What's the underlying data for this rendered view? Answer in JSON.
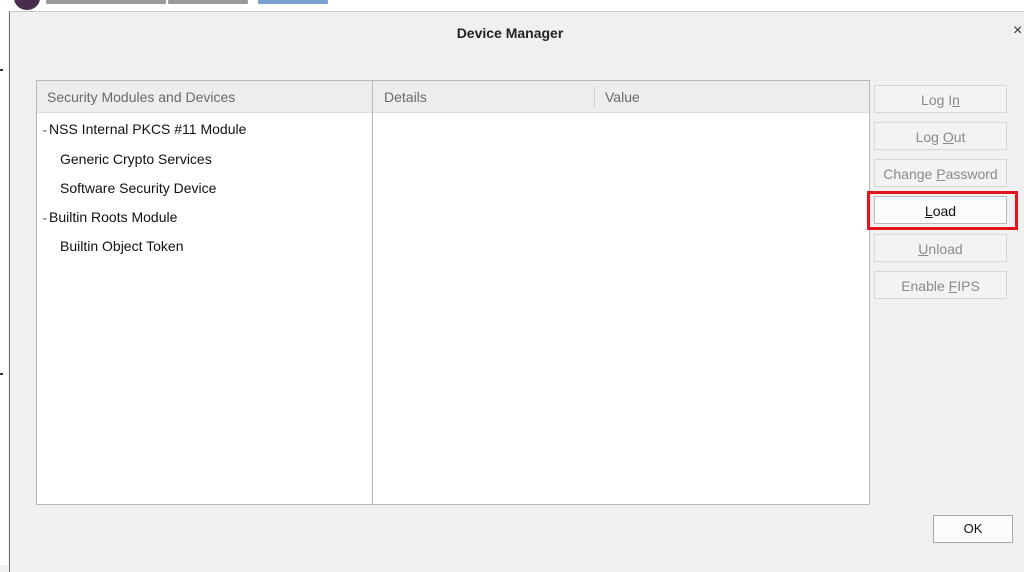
{
  "window": {
    "title": "Device Manager",
    "close_glyph": "×"
  },
  "modules_panel": {
    "header": "Security Modules and Devices",
    "items": [
      {
        "label": "NSS Internal PKCS #11 Module",
        "expanded": true,
        "level": 0
      },
      {
        "label": "Generic Crypto Services",
        "level": 1
      },
      {
        "label": "Software Security Device",
        "level": 1
      },
      {
        "label": "Builtin Roots Module",
        "expanded": true,
        "level": 0
      },
      {
        "label": "Builtin Object Token",
        "level": 1
      }
    ]
  },
  "details_panel": {
    "col_details": "Details",
    "col_value": "Value"
  },
  "actions": {
    "login": {
      "before": "Log I",
      "key": "n",
      "after": "",
      "enabled": false
    },
    "logout": {
      "before": "Log ",
      "key": "O",
      "after": "ut",
      "enabled": false
    },
    "change_password": {
      "before": "Change ",
      "key": "P",
      "after": "assword",
      "enabled": false
    },
    "load": {
      "before": "",
      "key": "L",
      "after": "oad",
      "enabled": true
    },
    "unload": {
      "before": "",
      "key": "U",
      "after": "nload",
      "enabled": false
    },
    "enable_fips": {
      "before": "Enable ",
      "key": "F",
      "after": "IPS",
      "enabled": false
    }
  },
  "ok_label": "OK",
  "highlight_color": "#e0151c",
  "chevron_glyph": "⌄"
}
